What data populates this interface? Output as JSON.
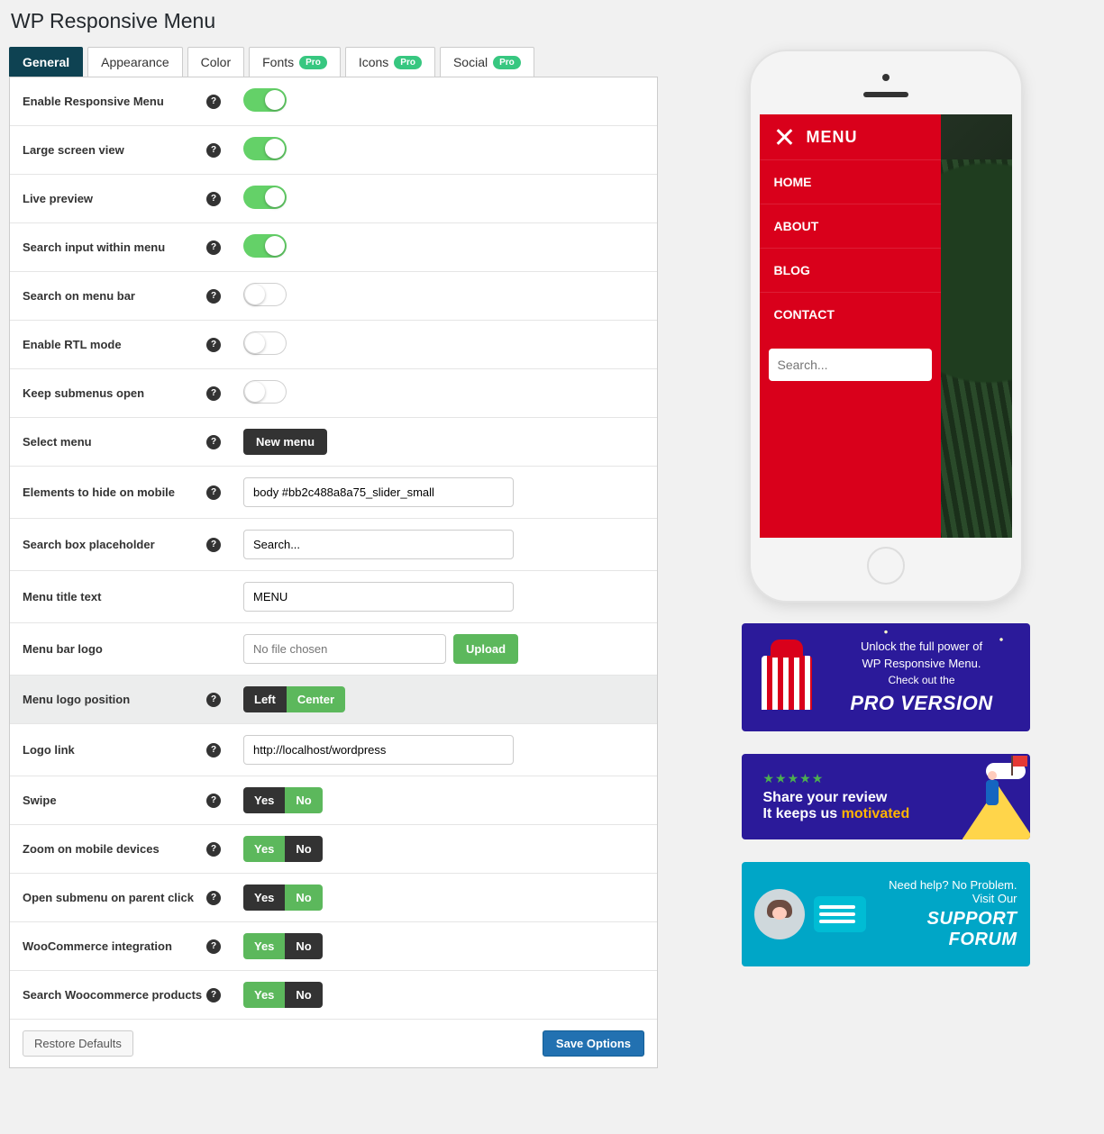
{
  "page_title": "WP Responsive Menu",
  "tabs": [
    {
      "label": "General",
      "pro": false,
      "active": true
    },
    {
      "label": "Appearance",
      "pro": false,
      "active": false
    },
    {
      "label": "Color",
      "pro": false,
      "active": false
    },
    {
      "label": "Fonts",
      "pro": true,
      "active": false
    },
    {
      "label": "Icons",
      "pro": true,
      "active": false
    },
    {
      "label": "Social",
      "pro": true,
      "active": false
    }
  ],
  "pro_label": "Pro",
  "rows": {
    "enable_responsive": {
      "label": "Enable Responsive Menu",
      "on": true
    },
    "large_screen": {
      "label": "Large screen view",
      "on": true
    },
    "live_preview": {
      "label": "Live preview",
      "on": true
    },
    "search_within": {
      "label": "Search input within menu",
      "on": true
    },
    "search_bar": {
      "label": "Search on menu bar",
      "on": false
    },
    "rtl": {
      "label": "Enable RTL mode",
      "on": false
    },
    "submenus_open": {
      "label": "Keep submenus open",
      "on": false
    },
    "select_menu": {
      "label": "Select menu",
      "button": "New menu"
    },
    "hide_elements": {
      "label": "Elements to hide on mobile",
      "value": "body #bb2c488a8a75_slider_small"
    },
    "search_placeholder": {
      "label": "Search box placeholder",
      "value": "Search..."
    },
    "menu_title": {
      "label": "Menu title text",
      "value": "MENU"
    },
    "bar_logo": {
      "label": "Menu bar logo",
      "placeholder": "No file chosen",
      "upload": "Upload"
    },
    "logo_position": {
      "label": "Menu logo position",
      "left": "Left",
      "center": "Center"
    },
    "logo_link": {
      "label": "Logo link",
      "value": "http://localhost/wordpress"
    },
    "swipe": {
      "label": "Swipe",
      "yes": "Yes",
      "no": "No",
      "value": "No"
    },
    "zoom": {
      "label": "Zoom on mobile devices",
      "yes": "Yes",
      "no": "No",
      "value": "Yes"
    },
    "open_parent": {
      "label": "Open submenu on parent click",
      "yes": "Yes",
      "no": "No",
      "value": "No"
    },
    "woo": {
      "label": "WooCommerce integration",
      "yes": "Yes",
      "no": "No",
      "value": "Yes"
    },
    "woo_search": {
      "label": "Search Woocommerce products",
      "yes": "Yes",
      "no": "No",
      "value": "Yes"
    }
  },
  "footer": {
    "restore": "Restore Defaults",
    "save": "Save Options"
  },
  "preview": {
    "menu_title": "MENU",
    "items": [
      "HOME",
      "ABOUT",
      "BLOG",
      "CONTACT"
    ],
    "search_placeholder": "Search..."
  },
  "promos": {
    "pro": {
      "line1": "Unlock the full power of",
      "line2": "WP Responsive Menu.",
      "line3": "Check out the",
      "big": "PRO VERSION"
    },
    "review": {
      "line1": "Share your review",
      "line2_a": "It keeps us ",
      "line2_b": "motivated"
    },
    "support": {
      "line1": "Need help? No Problem. Visit Our",
      "big": "SUPPORT FORUM"
    }
  }
}
